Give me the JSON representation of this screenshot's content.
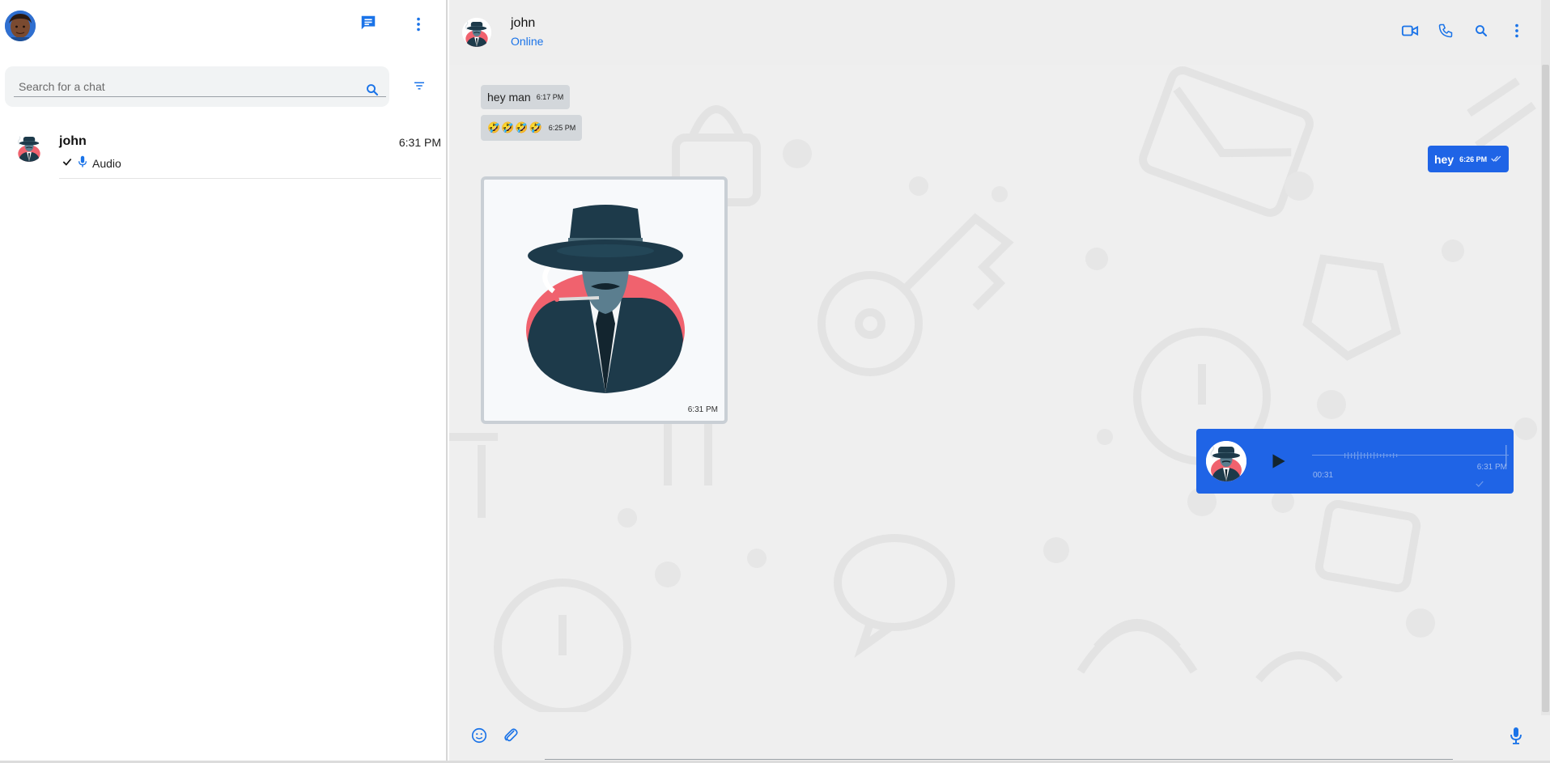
{
  "sidebar": {
    "search_placeholder": "Search for a chat",
    "chats": [
      {
        "name": "john",
        "time": "6:31 PM",
        "preview": "Audio"
      }
    ]
  },
  "chat": {
    "contact_name": "john",
    "contact_status": "Online",
    "messages": {
      "m1": {
        "text": "hey man",
        "time": "6:17 PM"
      },
      "m2": {
        "text": "🤣🤣🤣🤣",
        "time": "6:25 PM"
      },
      "m3": {
        "text": "hey",
        "time": "6:26 PM"
      },
      "m4": {
        "time": "6:31 PM"
      },
      "m5": {
        "duration": "00:31",
        "time": "6:31 PM"
      }
    }
  },
  "icons": {
    "new_chat": "chat-icon",
    "menu": "dots-vertical-icon",
    "search": "search-icon",
    "filter": "filter-icon",
    "video": "video-camera-icon",
    "phone": "phone-icon",
    "emoji": "emoji-icon",
    "attach": "paperclip-icon",
    "mic": "microphone-icon"
  },
  "colors": {
    "accent": "#1a73e8",
    "outgoing_bubble": "#1f64e6",
    "incoming_bubble": "#d3d7db",
    "chat_background": "#efefef"
  }
}
